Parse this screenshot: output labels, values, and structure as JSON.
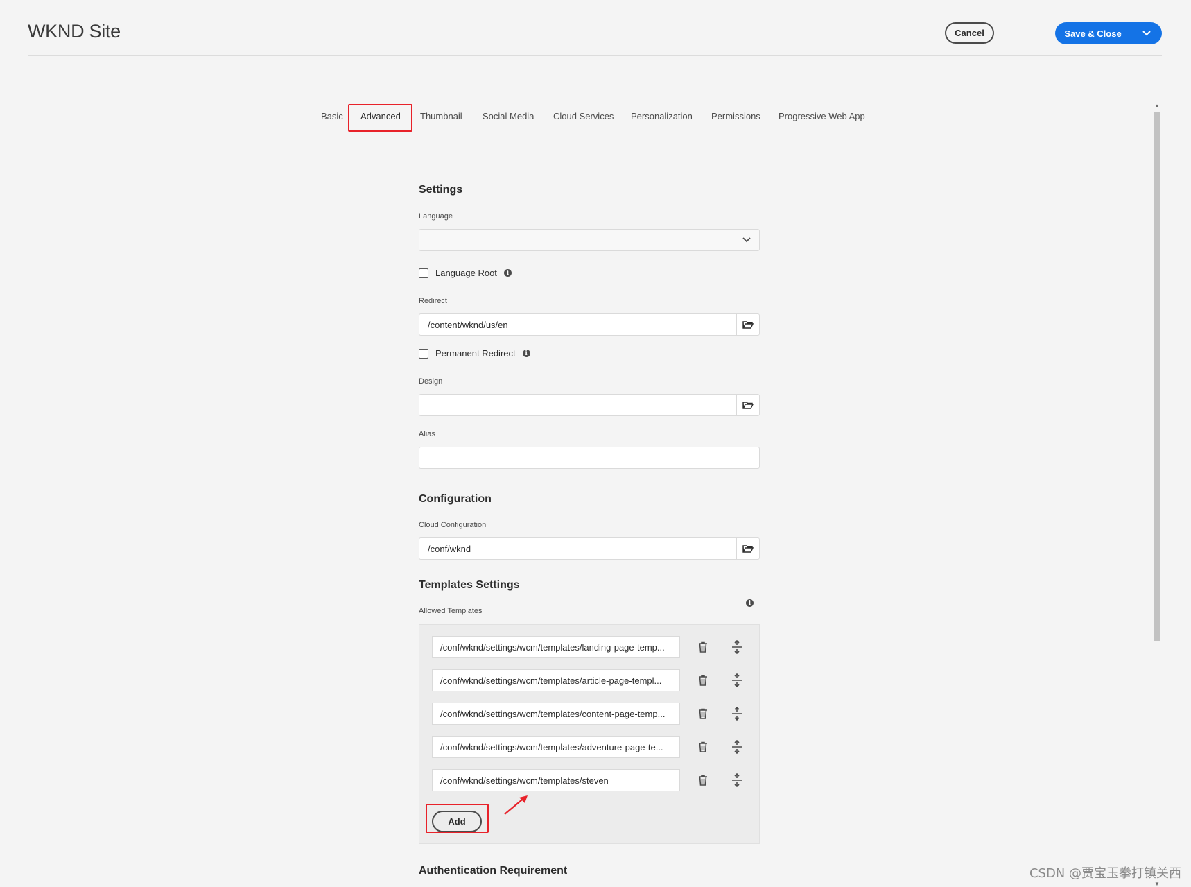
{
  "header": {
    "title": "WKND Site",
    "cancel_label": "Cancel",
    "save_label": "Save & Close"
  },
  "tabs": [
    {
      "label": "Basic"
    },
    {
      "label": "Advanced",
      "active": true
    },
    {
      "label": "Thumbnail"
    },
    {
      "label": "Social Media"
    },
    {
      "label": "Cloud Services"
    },
    {
      "label": "Personalization"
    },
    {
      "label": "Permissions"
    },
    {
      "label": "Progressive Web App"
    }
  ],
  "settings": {
    "heading": "Settings",
    "language_label": "Language",
    "language_value": "",
    "language_root_label": "Language Root",
    "redirect_label": "Redirect",
    "redirect_value": "/content/wknd/us/en",
    "permanent_redirect_label": "Permanent Redirect",
    "design_label": "Design",
    "design_value": "",
    "alias_label": "Alias",
    "alias_value": ""
  },
  "configuration": {
    "heading": "Configuration",
    "cloud_label": "Cloud Configuration",
    "cloud_value": "/conf/wknd"
  },
  "templates": {
    "heading": "Templates Settings",
    "allowed_label": "Allowed Templates",
    "items": [
      "/conf/wknd/settings/wcm/templates/landing-page-temp...",
      "/conf/wknd/settings/wcm/templates/article-page-templ...",
      "/conf/wknd/settings/wcm/templates/content-page-temp...",
      "/conf/wknd/settings/wcm/templates/adventure-page-te...",
      "/conf/wknd/settings/wcm/templates/steven"
    ],
    "add_label": "Add"
  },
  "auth": {
    "heading": "Authentication Requirement"
  },
  "watermark": "CSDN @贾宝玉拳打镇关西",
  "colors": {
    "accent": "#1473e6",
    "highlight": "#e8222a",
    "background": "#f4f4f4"
  }
}
